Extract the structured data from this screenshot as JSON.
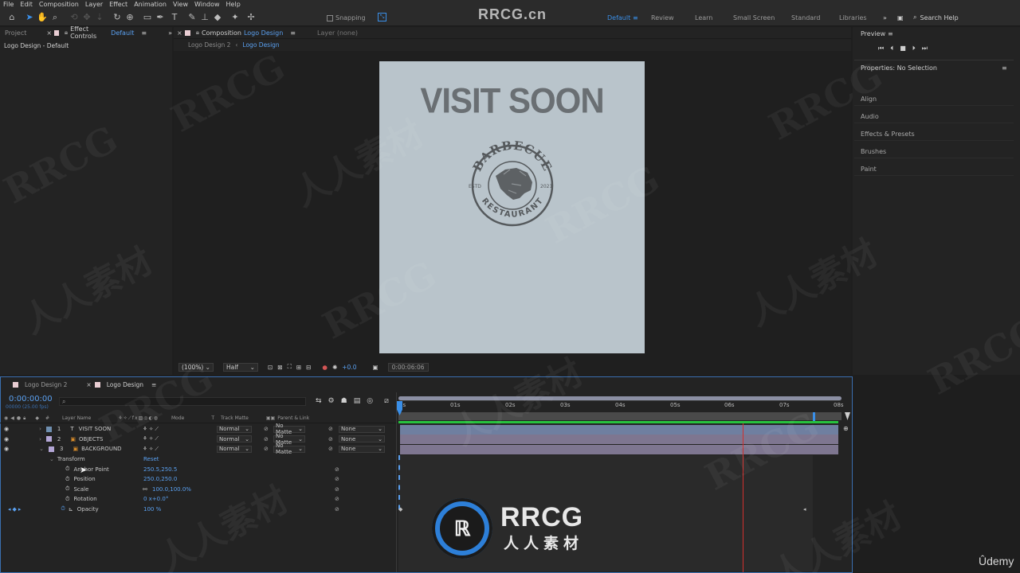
{
  "menu": [
    "File",
    "Edit",
    "Composition",
    "Layer",
    "Effect",
    "Animation",
    "View",
    "Window",
    "Help"
  ],
  "toolbar": {
    "snapping_label": "Snapping",
    "workspaces": [
      {
        "label": "Default",
        "active": true
      },
      {
        "label": "Review",
        "active": false
      },
      {
        "label": "Learn",
        "active": false
      },
      {
        "label": "Small Screen",
        "active": false
      },
      {
        "label": "Standard",
        "active": false
      },
      {
        "label": "Libraries",
        "active": false
      }
    ],
    "search_placeholder": "Search Help"
  },
  "watermark_text": "RRCG.cn",
  "project_panel": {
    "tab_project": "Project",
    "tab_effect_controls": "Effect Controls",
    "effect_controls_target": "Default",
    "subtitle": "Logo Design - Default"
  },
  "comp_panel": {
    "tab_label": "Composition",
    "tab_comp_name": "Logo Design",
    "layer_tab": "Layer (none)",
    "breadcrumb_parent": "Logo Design 2",
    "breadcrumb_current": "Logo Design",
    "zoom": "(100%)",
    "resolution": "Half",
    "exposure": "+0.0",
    "timecode": "0:00:06:06"
  },
  "artwork": {
    "headline": "VISIT SOON",
    "badge_top": "BARBECUE",
    "badge_bottom": "RESTAURANT",
    "badge_left": "ESTD",
    "badge_right": "2021"
  },
  "right_panel": {
    "preview_label": "Preview",
    "properties_label": "Properties: No Selection",
    "sections": [
      "Align",
      "Audio",
      "Effects & Presets",
      "Brushes",
      "Paint"
    ]
  },
  "timeline": {
    "tabs": [
      "Logo Design 2",
      "Logo Design"
    ],
    "current_time": "0:00:00:00",
    "frame_info": "00000 (25.00 fps)",
    "columns": {
      "layer_name": "Layer Name",
      "mode": "Mode",
      "t": "T",
      "track_matte": "Track Matte",
      "parent": "Parent & Link"
    },
    "layers": [
      {
        "num": "1",
        "name": "VISIT SOON",
        "mode": "Normal",
        "matte": "No Matte",
        "parent": "None",
        "color": "#6f8fb0"
      },
      {
        "num": "2",
        "name": "OBJECTS",
        "mode": "Normal",
        "matte": "No Matte",
        "parent": "None",
        "color": "#b3a6d6"
      },
      {
        "num": "3",
        "name": "BACKGROUND",
        "mode": "Normal",
        "matte": "No Matte",
        "parent": "None",
        "color": "#b3a6d6"
      }
    ],
    "transform": {
      "label": "Transform",
      "reset": "Reset",
      "properties": [
        {
          "name": "Anchor Point",
          "value": "250.5,250.5"
        },
        {
          "name": "Position",
          "value": "250.0,250.0"
        },
        {
          "name": "Scale",
          "value": "100.0,100.0%"
        },
        {
          "name": "Rotation",
          "value": "0 x+0.0°"
        },
        {
          "name": "Opacity",
          "value": "100 %"
        }
      ]
    },
    "ruler": [
      "0s",
      "01s",
      "02s",
      "03s",
      "04s",
      "05s",
      "06s",
      "07s",
      "08s"
    ]
  },
  "logo_overlay": {
    "brand": "RRCG",
    "tagline": "人人素材"
  },
  "udemy": "Ûdemy",
  "colors": {
    "accent": "#3a8fe8",
    "layer_bar": "#7e7690",
    "playhead": "#d0302e",
    "work_area": "#27c23e"
  }
}
